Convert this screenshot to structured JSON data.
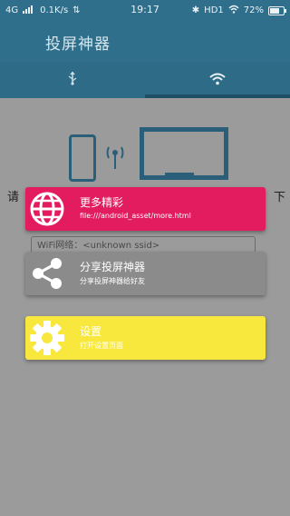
{
  "status": {
    "network": "4G",
    "speed": "0.1K/s",
    "time": "19:17",
    "right_text": "HD1",
    "battery_text": "72%",
    "battery_level": 0.72
  },
  "app": {
    "title": "投屏神器"
  },
  "tabs": [
    {
      "icon": "usb-icon",
      "selected": false
    },
    {
      "icon": "wifi-icon",
      "selected": true
    }
  ],
  "background": {
    "left_char": "请",
    "right_char": "下",
    "wifi_field_text": "WiFi网络：<unknown ssid>"
  },
  "menu": [
    {
      "title": "更多精彩",
      "subtitle": "file:///android_asset/more.html",
      "icon": "globe-icon",
      "color": "#e31b5f"
    },
    {
      "title": "分享投屏神器",
      "subtitle": "分享投屏神器给好友",
      "icon": "share-icon",
      "color": "#8b8b8b"
    },
    {
      "title": "设置",
      "subtitle": "打开设置页面",
      "icon": "gear-icon",
      "color": "#f8e83e"
    }
  ]
}
